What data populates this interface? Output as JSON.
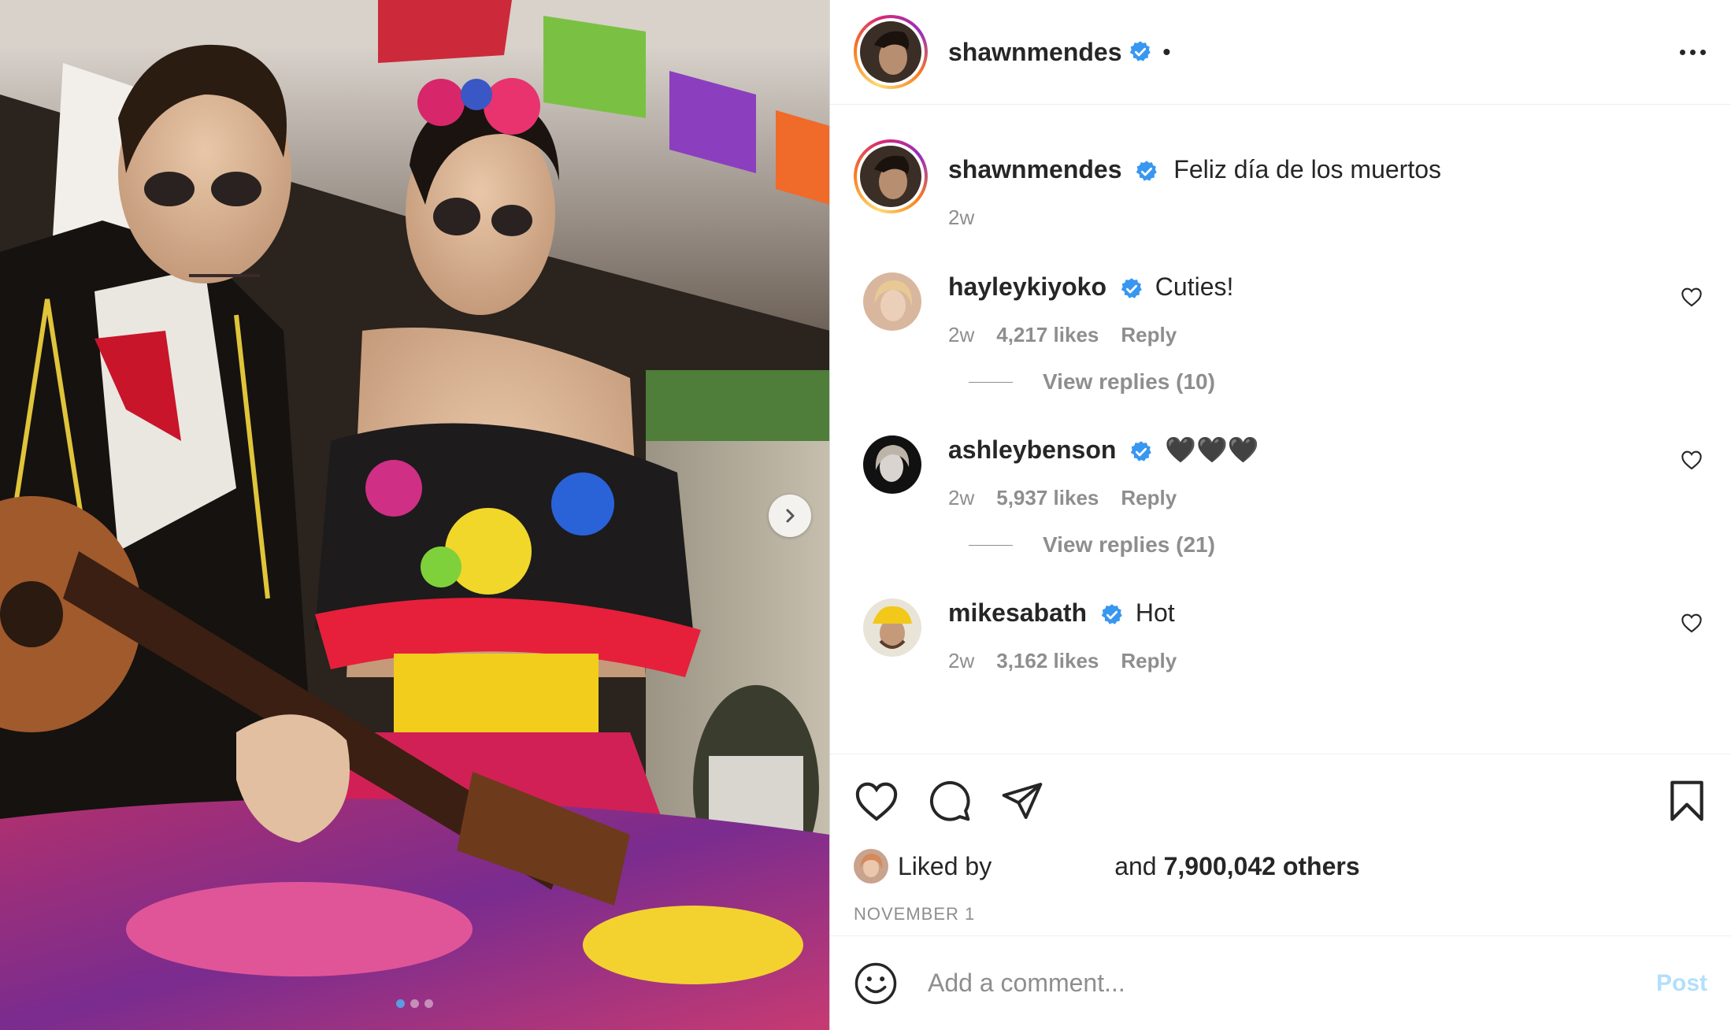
{
  "post": {
    "author": "shawnmendes",
    "author_verified": true,
    "bullet": "•",
    "more_icon": "more-horizontal-icon"
  },
  "caption": {
    "username": "shawnmendes",
    "text": "Feliz día de los muertos",
    "time": "2w"
  },
  "comments": [
    {
      "username": "hayleykiyoko",
      "text": "Cuties!",
      "time": "2w",
      "likes": "4,217 likes",
      "reply_label": "Reply",
      "view_replies": "View replies (10)"
    },
    {
      "username": "ashleybenson",
      "text": "🖤🖤🖤",
      "time": "2w",
      "likes": "5,937 likes",
      "reply_label": "Reply",
      "view_replies": "View replies (21)"
    },
    {
      "username": "mikesabath",
      "text": "Hot",
      "time": "2w",
      "likes": "3,162 likes",
      "reply_label": "Reply"
    }
  ],
  "actions": {
    "like_icon": "heart-icon",
    "comment_icon": "comment-icon",
    "share_icon": "send-icon",
    "save_icon": "bookmark-icon"
  },
  "likes": {
    "liked_by": "Liked by",
    "and": "and",
    "others": "7,900,042 others"
  },
  "date": "NOVEMBER 1",
  "add_comment": {
    "placeholder": "Add a comment...",
    "post_label": "Post",
    "emoji_icon": "emoji-smile-icon"
  },
  "carousel": {
    "slides": 3,
    "active_index": 0
  },
  "colors": {
    "text": "#262626",
    "secondary": "#8e8e8e",
    "verified": "#3897f0",
    "post_disabled": "#b2dffc",
    "border": "#efefef"
  }
}
